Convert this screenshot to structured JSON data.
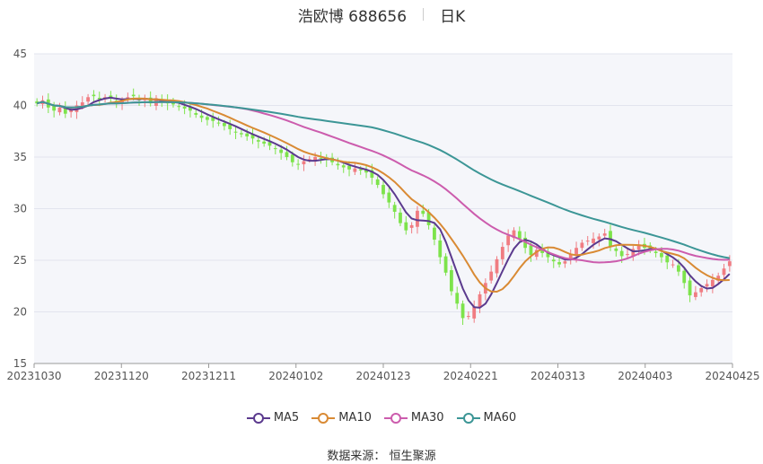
{
  "title": {
    "name": "浩欧博 688656",
    "period": "日K"
  },
  "source": {
    "label": "数据来源：",
    "value": "恒生聚源"
  },
  "chart_data": {
    "type": "candlestick",
    "ylim": [
      15,
      45
    ],
    "y_ticks": [
      15,
      20,
      25,
      30,
      35,
      40,
      45
    ],
    "x_ticks": [
      "20231030",
      "20231120",
      "20231211",
      "20240102",
      "20240123",
      "20240221",
      "20240313",
      "20240403",
      "20240425"
    ],
    "grid": true,
    "legend_position": "bottom",
    "colors": {
      "up": "#f07c82",
      "down": "#7de34b",
      "plot_bg": "#f5f6fa",
      "grid": "#e2e4ee"
    },
    "series": [
      {
        "name": "MA5",
        "color": "#5b3a8e"
      },
      {
        "name": "MA10",
        "color": "#d98a34"
      },
      {
        "name": "MA30",
        "color": "#cc5cad"
      },
      {
        "name": "MA60",
        "color": "#3c9696"
      }
    ],
    "close": [
      40.2,
      40.5,
      39.8,
      39.5,
      39.8,
      39.2,
      39.6,
      40.0,
      40.3,
      40.8,
      40.9,
      40.6,
      40.8,
      40.7,
      40.3,
      40.5,
      40.8,
      40.9,
      40.5,
      40.6,
      40.2,
      40.7,
      40.4,
      40.2,
      40.1,
      39.9,
      39.7,
      39.5,
      39.1,
      38.8,
      38.6,
      38.5,
      38.3,
      38.0,
      37.7,
      37.4,
      37.2,
      37.0,
      36.8,
      36.5,
      36.3,
      36.1,
      35.8,
      35.4,
      35.0,
      34.5,
      34.3,
      34.6,
      34.8,
      35.0,
      34.9,
      34.7,
      34.5,
      34.2,
      34.0,
      33.8,
      33.9,
      33.7,
      33.5,
      33.0,
      32.3,
      31.4,
      30.6,
      29.7,
      28.6,
      27.9,
      28.4,
      29.8,
      29.5,
      28.4,
      27.0,
      25.3,
      23.8,
      22.0,
      20.8,
      19.4,
      19.6,
      20.5,
      21.7,
      22.8,
      23.9,
      25.1,
      26.3,
      27.4,
      27.9,
      27.1,
      26.2,
      25.5,
      26.0,
      25.7,
      25.3,
      24.9,
      24.6,
      24.9,
      25.6,
      26.2,
      26.7,
      26.9,
      27.1,
      27.3,
      27.6,
      26.3,
      25.9,
      25.4,
      25.6,
      26.1,
      26.5,
      26.2,
      26.0,
      25.7,
      25.3,
      24.8,
      24.6,
      23.9,
      22.8,
      21.6,
      21.9,
      22.3,
      22.7,
      23.1,
      23.5,
      24.2,
      24.9
    ]
  }
}
